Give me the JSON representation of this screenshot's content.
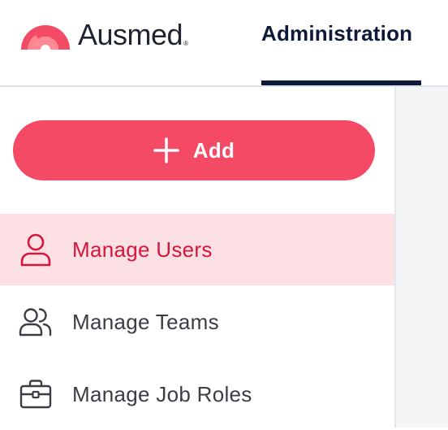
{
  "brand": {
    "name": "Ausmed",
    "registered_mark": "®",
    "colors": {
      "brand_red": "#f44a65",
      "brand_pink": "#ff8a96",
      "text_dark": "#1f2430"
    }
  },
  "nav": {
    "tabs": [
      {
        "label": "Administration",
        "active": true
      }
    ],
    "active_indicator_color": "#0e1a3a"
  },
  "sidebar": {
    "add_button": {
      "label": "Add",
      "icon": "plus-icon",
      "color": "#f44a65"
    },
    "items": [
      {
        "label": "Manage Users",
        "icon": "user-icon",
        "active": true
      },
      {
        "label": "Manage Teams",
        "icon": "users-icon",
        "active": false
      },
      {
        "label": "Manage Job Roles",
        "icon": "briefcase-icon",
        "active": false
      }
    ],
    "active_bg": "#fce0e4",
    "active_text": "#d4163c"
  }
}
